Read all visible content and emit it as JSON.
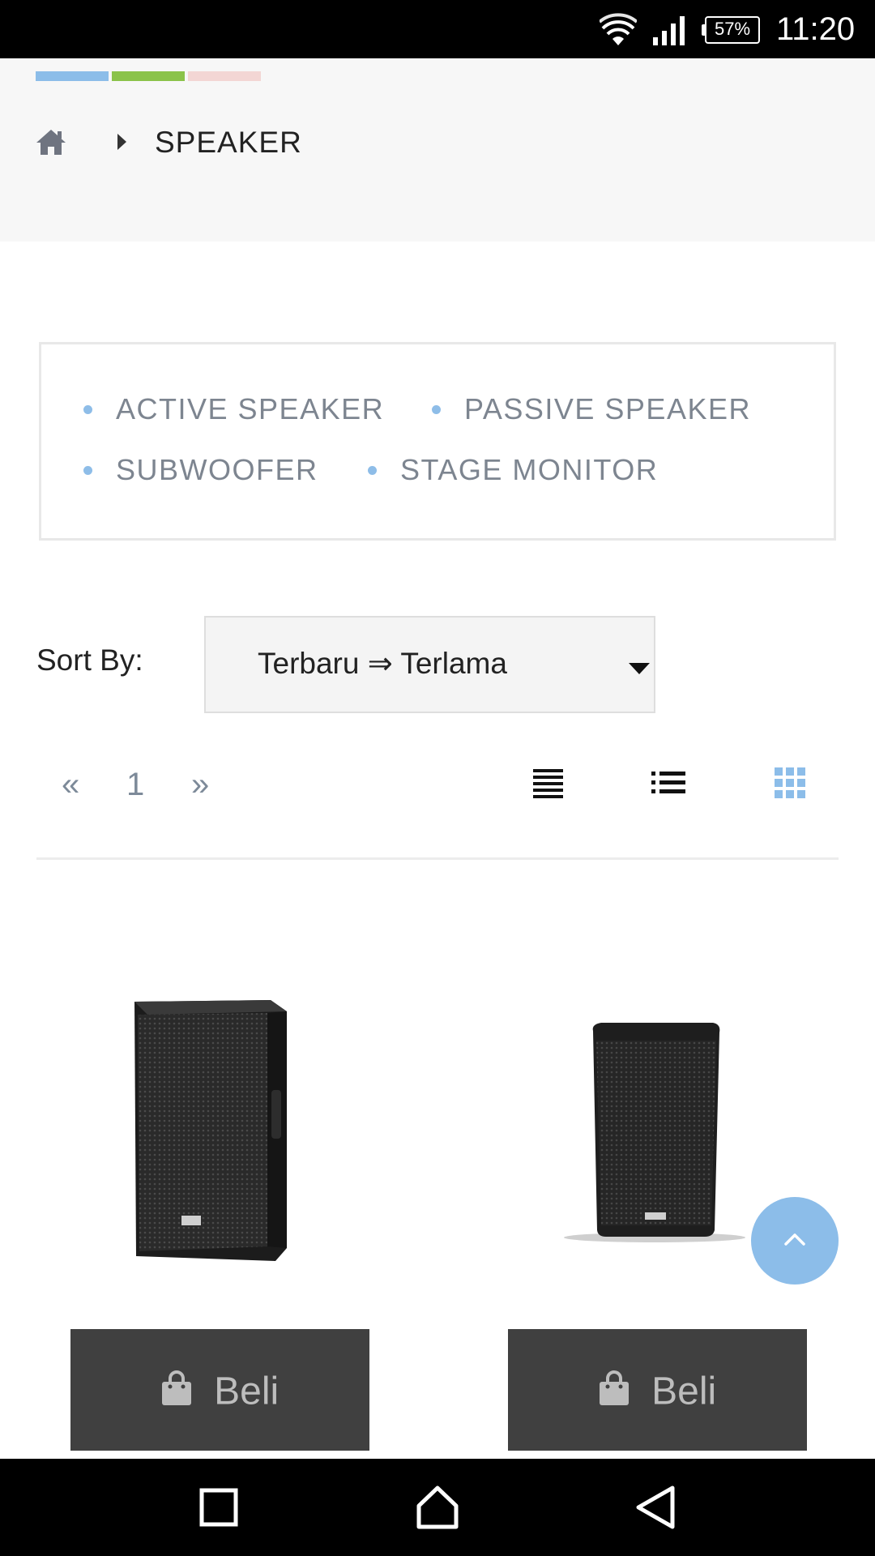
{
  "status_bar": {
    "battery": "57%",
    "time": "11:20",
    "icons": [
      "wifi-icon",
      "signal-icon",
      "battery-icon"
    ]
  },
  "header": {
    "color_strip": [
      "#8cbde9",
      "#8bc34a",
      "#f3d6d4"
    ],
    "breadcrumb": {
      "home_icon": "home-icon",
      "separator_icon": "chevron-right-icon",
      "current": "SPEAKER"
    }
  },
  "categories": [
    {
      "label": "ACTIVE SPEAKER"
    },
    {
      "label": "PASSIVE SPEAKER"
    },
    {
      "label": "SUBWOOFER"
    },
    {
      "label": "STAGE MONITOR"
    }
  ],
  "sort": {
    "label": "Sort By:",
    "selected": "Terbaru ⇒ Terlama"
  },
  "pagination": {
    "prev": "«",
    "page": "1",
    "next": "»"
  },
  "view_modes": {
    "icons": [
      "list-detail-icon",
      "list-icon",
      "grid-icon"
    ],
    "active": "grid-icon",
    "active_color": "#8cbde9"
  },
  "products": [
    {
      "image_icon": "speaker-image",
      "buy_label": "Beli",
      "buy_icon": "shopping-bag-icon"
    },
    {
      "image_icon": "speaker-image",
      "buy_label": "Beli",
      "buy_icon": "shopping-bag-icon"
    }
  ],
  "floating": {
    "icon": "chevron-up-icon"
  },
  "nav_bar": {
    "icons": [
      "recents-icon",
      "home-nav-icon",
      "back-icon"
    ]
  },
  "colors": {
    "accent": "#8cbde9",
    "button_dark": "#404040",
    "category_text": "#7d8590"
  }
}
